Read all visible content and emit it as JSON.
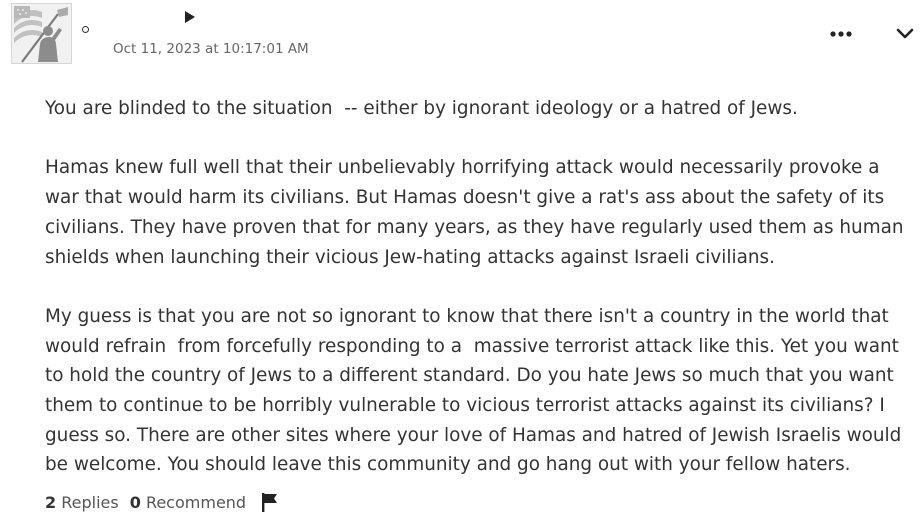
{
  "comment": {
    "author_status_icon": "circle-outline-icon",
    "author_name": "",
    "timestamp": "Oct 11, 2023 at 10:17:01 AM",
    "more_icon": "ellipsis-icon",
    "collapse_icon": "chevron-down-icon",
    "paragraphs": [
      "You are blinded to the situation  -- either by ignorant ideology or a hatred of Jews.",
      "Hamas knew full well that their unbelievably horrifying attack would necessarily provoke a war that would harm its civilians. But Hamas doesn't give a rat's ass about the safety of its civilians. They have proven that for many years, as they have regularly used them as human shields when launching their vicious Jew-hating attacks against Israeli civilians.",
      "My guess is that you are not so ignorant to know that there isn't a country in the world that would refrain  from forcefully responding to a  massive terrorist attack like this. Yet you want to hold the country of Jews to a different standard. Do you hate Jews so much that you want them to continue to be horribly vulnerable to vicious terrorist attacks against its civilians? I guess so. There are other sites where your love of Hamas and hatred of Jewish Israelis would be welcome. You should leave this community and go hang out with your fellow haters."
    ],
    "footer": {
      "replies_count": "2",
      "replies_label": "Replies",
      "recommend_count": "0",
      "recommend_label": "Recommend",
      "flag_icon": "flag-icon"
    }
  },
  "colors": {
    "text": "#333333",
    "muted": "#666666",
    "icon": "#222222"
  }
}
